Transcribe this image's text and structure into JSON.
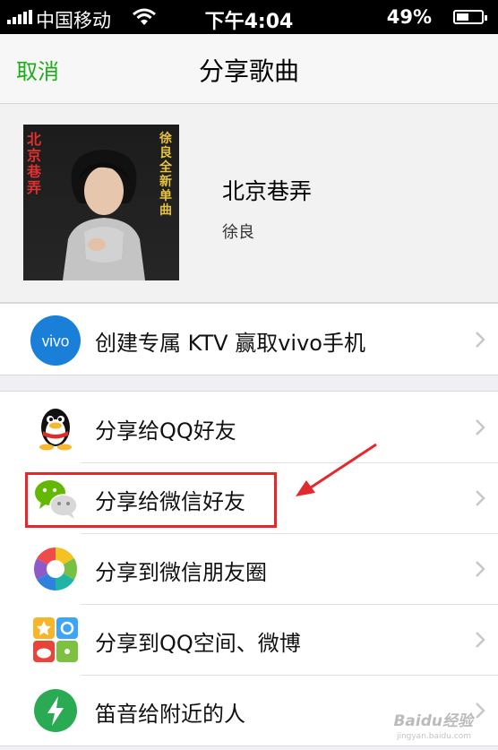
{
  "status": {
    "carrier": "中国移动",
    "time": "下午4:04",
    "battery_percent": "49%",
    "battery_level": 0.49
  },
  "nav": {
    "cancel_label": "取消",
    "title": "分享歌曲"
  },
  "song": {
    "title": "北京巷弄",
    "artist": "徐良",
    "cover_text_left": "北京巷弄",
    "cover_text_right": "徐良全新单曲"
  },
  "promo": {
    "label": "创建专属 KTV 赢取vivo手机",
    "icon_text": "vivo",
    "icon": "vivo-logo-icon"
  },
  "share_options": [
    {
      "label": "分享给QQ好友",
      "icon": "qq-penguin-icon"
    },
    {
      "label": "分享给微信好友",
      "icon": "wechat-icon"
    },
    {
      "label": "分享到微信朋友圈",
      "icon": "moments-aperture-icon"
    },
    {
      "label": "分享到QQ空间、微博",
      "icon": "qzone-weibo-icon"
    },
    {
      "label": "笛音给附近的人",
      "icon": "lightning-icon"
    }
  ],
  "watermark": {
    "brand": "Baidu经验",
    "url": "jingyan.baidu.com"
  },
  "colors": {
    "accent": "#1aad19",
    "highlight": "#e4292c",
    "vivo_blue": "#1a7fd8"
  }
}
